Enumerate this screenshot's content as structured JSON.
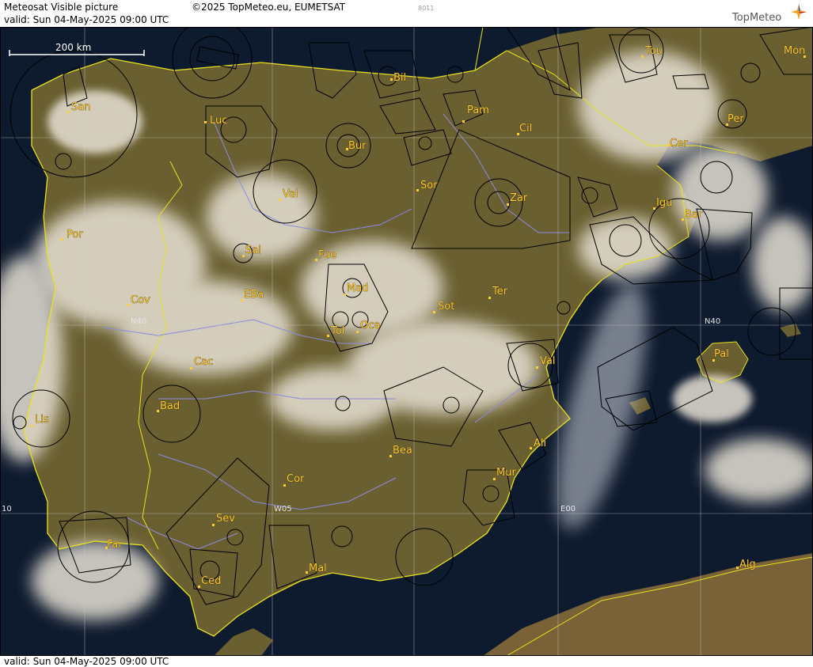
{
  "header": {
    "title": "Meteosat Visible picture",
    "valid": "valid:  Sun  04-May-2025  09:00 UTC",
    "copyright": "©2025 TopMeteo.eu, EUMETSAT",
    "code": "8011",
    "logo_text": "TopMeteo"
  },
  "footer": {
    "valid": "valid:  Sun  04-May-2025  09:00 UTC"
  },
  "scale_bar": {
    "label": "200 km"
  },
  "grid_labels": {
    "n40_west": "N40",
    "n40_east": "N40",
    "w05": "W05",
    "e00": "E00",
    "w10": "10"
  },
  "cities": {
    "san": "San",
    "luc": "Luc",
    "bil": "Bil",
    "pam": "Pam",
    "cil": "Cil",
    "tou": "Tou",
    "mon": "Mon",
    "per": "Per",
    "cer": "Cer",
    "bur": "Bur",
    "val_n": "Val",
    "sor": "Sor",
    "zar": "Zar",
    "igu": "Igu",
    "bar": "Bar",
    "por": "Por",
    "sal": "Sal",
    "fue": "Fue",
    "mad": "Mad",
    "cov": "Cov",
    "eba": "EBa",
    "sot": "Sot",
    "ter": "Ter",
    "tol": "Tol",
    "oca": "Oca",
    "cac": "Cac",
    "val_e": "Val",
    "pal": "Pal",
    "lis": "Lis",
    "bad": "Bad",
    "ali": "Ali",
    "bea": "Bea",
    "mur": "Mur",
    "cor": "Cor",
    "sev": "Sev",
    "far": "Far",
    "mal": "Mal",
    "ced": "Ced",
    "alg": "Alg"
  },
  "colors": {
    "sea": "#0e1a2e",
    "land": "#6a5f30",
    "cloud": "#e8e2d6",
    "coast": "#e8e21a",
    "rivers": "#8a8ce0",
    "airspace": "#000000",
    "city_label": "#ffcc33",
    "grid": "#c8c8c8"
  }
}
